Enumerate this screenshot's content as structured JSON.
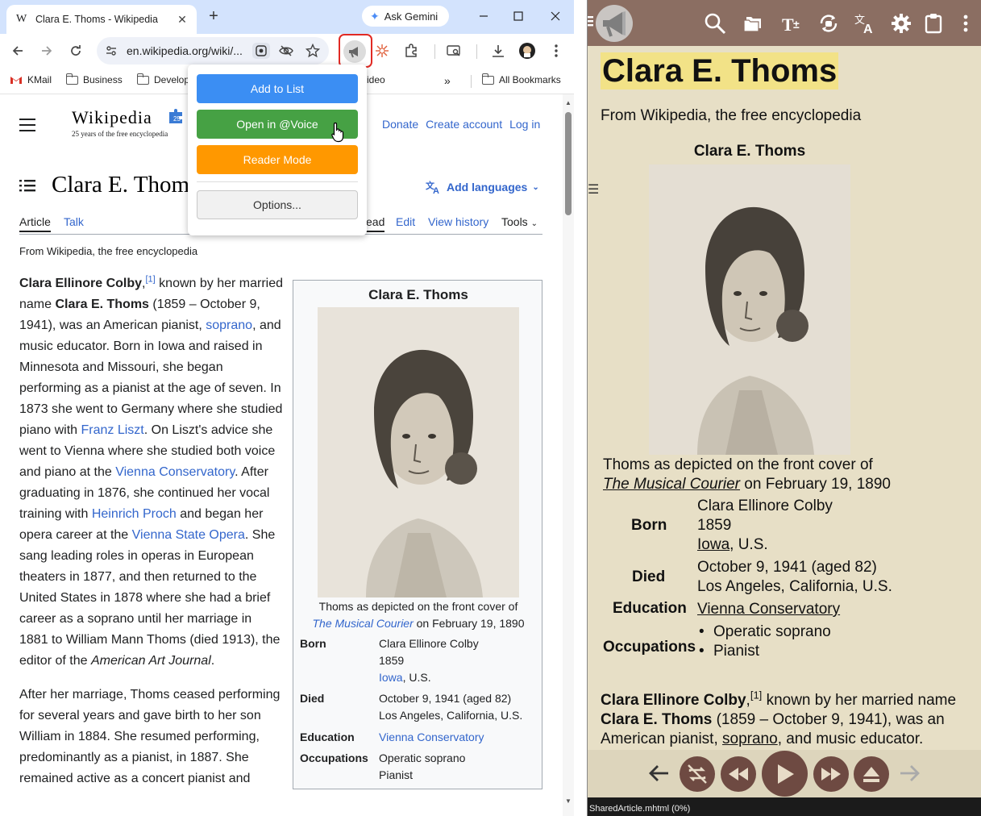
{
  "browser": {
    "tab_title": "Clara E. Thoms - Wikipedia",
    "tab_favicon": "W",
    "ask_gemini": "Ask Gemini",
    "url": "en.wikipedia.org/wiki/...",
    "bookmarks": [
      {
        "label": "KMail"
      },
      {
        "label": "Business"
      },
      {
        "label": "Develop"
      },
      {
        "label": "ideo"
      },
      {
        "label": "All Bookmarks"
      }
    ]
  },
  "popup": {
    "add_to_list": "Add to List",
    "open_in_voice": "Open in @Voice",
    "reader_mode": "Reader Mode",
    "options": "Options...",
    "colors": {
      "add": "#3b8ef3",
      "open": "#46a144",
      "reader": "#ff9800"
    }
  },
  "wiki": {
    "logo": "Wikipedia",
    "logo_sub": "25 years of the free encyclopedia",
    "header_links": [
      "Donate",
      "Create account",
      "Log in"
    ],
    "title": "Clara E. Thoms",
    "add_languages": "Add languages",
    "tabs_left": [
      "Article",
      "Talk"
    ],
    "tabs_right": [
      "ead",
      "Edit",
      "View history",
      "Tools"
    ],
    "from": "From Wikipedia, the free encyclopedia",
    "infobox": {
      "title": "Clara E. Thoms",
      "caption_1": "Thoms as depicted on the front cover of",
      "caption_link": "The Musical Courier",
      "caption_2": " on February 19, 1890",
      "born_label": "Born",
      "born_name": "Clara Ellinore Colby",
      "born_year": "1859",
      "born_place_link": "Iowa",
      "born_place_rest": ", U.S.",
      "died_label": "Died",
      "died_date": "October 9, 1941 (aged 82)",
      "died_place": "Los Angeles, California, U.S.",
      "education_label": "Education",
      "education": "Vienna Conservatory",
      "occupations_label": "Occupations",
      "occupation_1": "Operatic soprano",
      "occupation_2": "Pianist"
    }
  },
  "reader": {
    "title": "Clara E. Thoms",
    "from": "From Wikipedia, the free encyclopedia",
    "infobox_title": "Clara E. Thoms",
    "caption_1": "Thoms as depicted on the front cover of",
    "caption_link": "The Musical Courier",
    "caption_2": " on February 19, 1890",
    "born_label": "Born",
    "born_name": "Clara Ellinore Colby",
    "born_year": "1859",
    "born_place_link": "Iowa",
    "born_place_rest": ", U.S.",
    "died_label": "Died",
    "died_date": "October 9, 1941 (aged 82)",
    "died_place": "Los Angeles, California, U.S.",
    "education_label": "Education",
    "education": "Vienna Conservatory",
    "occupations_label": "Occupations",
    "occupation_1": "Operatic soprano",
    "occupation_2": "Pianist",
    "body_bold1": "Clara Ellinore Colby",
    "body_sup": "[1]",
    "body_t1": " known by her married name ",
    "body_bold2": "Clara E. Thoms",
    "body_t2": " (1859 – October 9, 1941), was an American pianist, ",
    "body_link": "soprano",
    "body_t3": ", and music educator.",
    "status": "SharedArticle.mhtml (0%)",
    "colors": {
      "toolbar": "#8b6e62",
      "background": "#e7dfc6",
      "highlight": "#f2e287",
      "button": "#6e4a42"
    }
  }
}
